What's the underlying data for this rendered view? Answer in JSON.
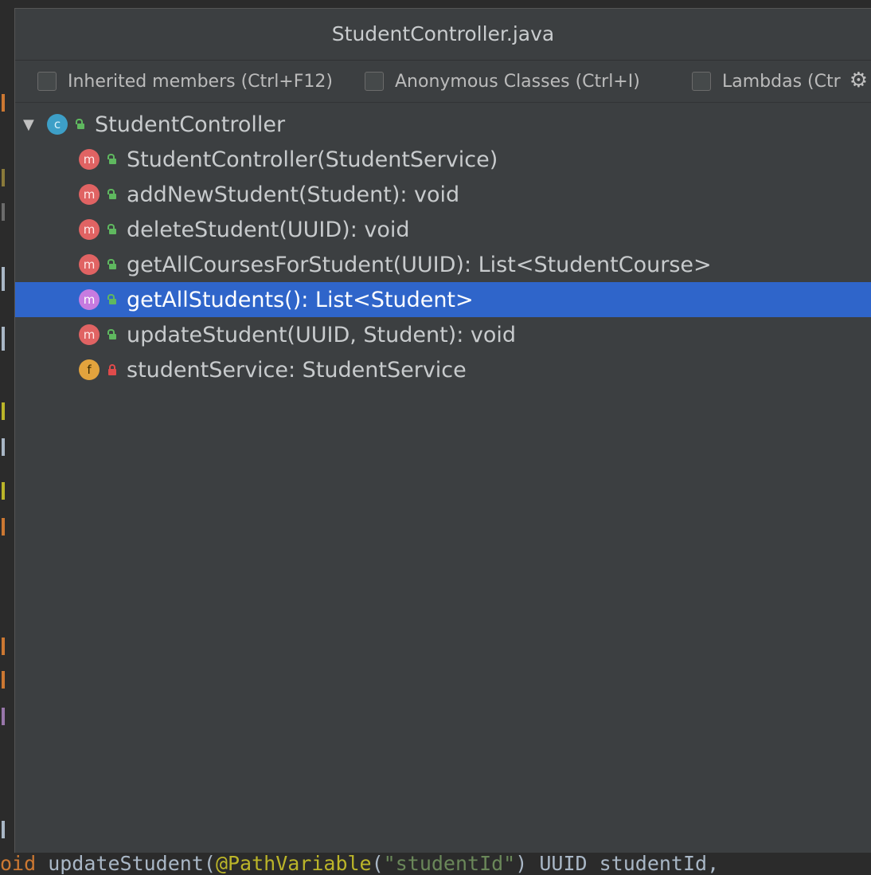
{
  "popup": {
    "title": "StudentController.java",
    "filters": [
      {
        "label": "Inherited members (Ctrl+F12)",
        "checked": false
      },
      {
        "label": "Anonymous Classes (Ctrl+I)",
        "checked": false
      },
      {
        "label": "Lambdas (Ctr",
        "checked": false
      }
    ]
  },
  "tree": {
    "root": {
      "label": "StudentController",
      "kind": "c",
      "visibility": "public",
      "expanded": true
    },
    "items": [
      {
        "label": "StudentController(StudentService)",
        "kind": "m",
        "visibility": "public"
      },
      {
        "label": "addNewStudent(Student): void",
        "kind": "m",
        "visibility": "public"
      },
      {
        "label": "deleteStudent(UUID): void",
        "kind": "m",
        "visibility": "public"
      },
      {
        "label": "getAllCoursesForStudent(UUID): List<StudentCourse>",
        "kind": "m",
        "visibility": "public"
      },
      {
        "label": "getAllStudents(): List<Student>",
        "kind": "m",
        "visibility": "public",
        "selected": true
      },
      {
        "label": "updateStudent(UUID, Student): void",
        "kind": "m",
        "visibility": "public"
      },
      {
        "label": "studentService: StudentService",
        "kind": "f",
        "visibility": "private"
      }
    ]
  },
  "editor": {
    "code": {
      "p1": "oid",
      "p2": " updateStudent(",
      "p3": "@PathVariable",
      "p4": "(",
      "p5": "\"studentId\"",
      "p6": ") UUID studentId,"
    }
  },
  "colors": {
    "selection": "#2f65ca",
    "popup_bg": "#3c3f41",
    "method_icon": "#e06363",
    "class_icon": "#3d9fc7",
    "field_icon": "#e2a33d"
  }
}
